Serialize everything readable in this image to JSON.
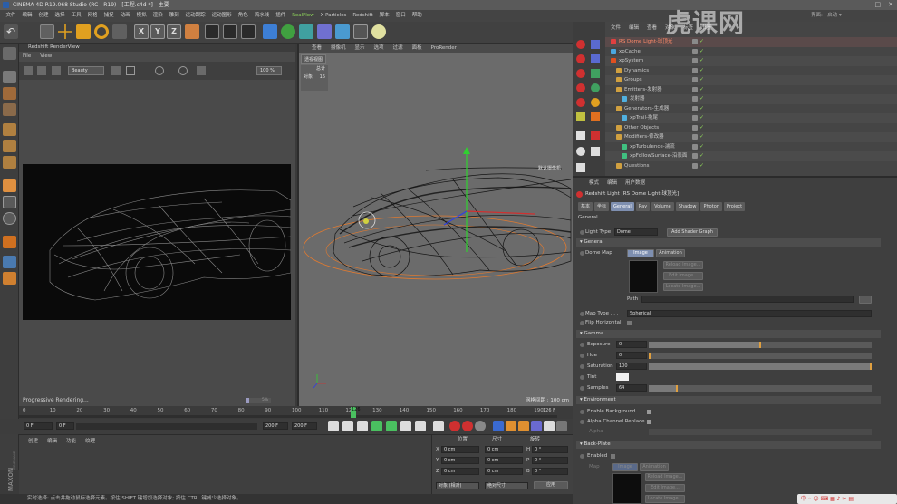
{
  "window": {
    "title": "CINEMA 4D R19.068 Studio (RC - R19) - [工程.c4d *] - 主要",
    "controls": [
      "—",
      "□",
      "✕"
    ],
    "layout_label": "界面: | 启动 ▾"
  },
  "menubar": [
    "文件",
    "编辑",
    "创建",
    "选择",
    "工具",
    "网格",
    "捕捉",
    "动画",
    "模拟",
    "渲染",
    "雕刻",
    "运动跟踪",
    "运动图形",
    "角色",
    "流水线",
    "插件",
    "RealFlow",
    "X-Particles",
    "Redshift",
    "脚本",
    "窗口",
    "帮助"
  ],
  "toolbar": {
    "axes": [
      "X",
      "Y",
      "Z"
    ]
  },
  "render_view": {
    "title": "Redshift RenderView",
    "menu": [
      "File",
      "View"
    ],
    "aov": "Beauty",
    "zoom": "100 %",
    "status": "Progressive Rendering...",
    "progress_label": "5%"
  },
  "viewport": {
    "menu": [
      "查看",
      "摄像机",
      "显示",
      "选项",
      "过滤",
      "面板",
      "ProRender"
    ],
    "tab": "透视视图",
    "stats_title": "总计",
    "stats_label": "对象",
    "stats_value": "16",
    "camera_label": "默认摄像机",
    "scale": "网格间距 : 100 cm"
  },
  "object_manager": {
    "menu": [
      "文件",
      "编辑",
      "查看",
      "对象",
      "标签",
      "书签"
    ],
    "items": [
      {
        "name": "RS Dome Light-球顶光",
        "indent": 0,
        "color": "#e04040",
        "selected": true
      },
      {
        "name": "xpCache",
        "indent": 0,
        "color": "#4aa8e0"
      },
      {
        "name": "xpSystem",
        "indent": 0,
        "color": "#e05020"
      },
      {
        "name": "Dynamics",
        "indent": 1,
        "color": "#d0a040"
      },
      {
        "name": "Groups",
        "indent": 1,
        "color": "#d0a040"
      },
      {
        "name": "Emitters-发射器",
        "indent": 1,
        "color": "#d0a040"
      },
      {
        "name": "发射器",
        "indent": 2,
        "color": "#50b0e0"
      },
      {
        "name": "Generators-生成器",
        "indent": 1,
        "color": "#d0a040"
      },
      {
        "name": "xpTrail-拖尾",
        "indent": 2,
        "color": "#50b0e0"
      },
      {
        "name": "Other Objects",
        "indent": 1,
        "color": "#d0a040"
      },
      {
        "name": "Modifiers-修改器",
        "indent": 1,
        "color": "#d0a040"
      },
      {
        "name": "xpTurbulence-湍流",
        "indent": 2,
        "color": "#40c080"
      },
      {
        "name": "xpFollowSurface-沿表面",
        "indent": 2,
        "color": "#40c080"
      },
      {
        "name": "Questions",
        "indent": 1,
        "color": "#d0a040"
      }
    ]
  },
  "attributes": {
    "menu": [
      "模式",
      "编辑",
      "用户数据"
    ],
    "header": "Redshift Light [RS Dome Light-球顶光]",
    "tabs": [
      {
        "label": "基本",
        "active": false
      },
      {
        "label": "坐标",
        "active": false
      },
      {
        "label": "General",
        "active": true
      },
      {
        "label": "Ray",
        "active": false
      },
      {
        "label": "Volume",
        "active": false
      },
      {
        "label": "Shadow",
        "active": false
      },
      {
        "label": "Photon",
        "active": false
      },
      {
        "label": "Project",
        "active": false
      }
    ],
    "section_general": "General",
    "light_type_label": "Light Type",
    "light_type_value": "Dome",
    "add_shader_graph": "Add Shader Graph",
    "sub_general": "▾ General",
    "dome_map_label": "Dome Map",
    "dome_tabs": [
      "Image",
      "Animation"
    ],
    "reload_image": "Reload Image...",
    "edit_image": "Edit Image...",
    "locate_image": "Locate Image...",
    "path_label": "Path",
    "map_type_label": "Map Type . . .",
    "map_type_value": "Spherical",
    "flip_horizontal": "Flip Horizontal",
    "sub_gamma": "▾ Gamma",
    "exposure_label": "Exposure",
    "exposure_value": "0",
    "hue_label": "Hue",
    "hue_value": "0",
    "saturation_label": "Saturation",
    "saturation_value": "100",
    "tint_label": "Tint",
    "samples_label": "Samples",
    "samples_value": "64",
    "section_environment": "▾ Environment",
    "enable_background": "Enable Background",
    "alpha_channel_replace": "Alpha Channel Replace",
    "alpha_label": "Alpha",
    "section_backplate": "▾ Back-Plate",
    "enabled_label": "Enabled",
    "map_label": "Map"
  },
  "timeline": {
    "ticks": [
      "0",
      "10",
      "20",
      "30",
      "40",
      "50",
      "60",
      "70",
      "80",
      "90",
      "100",
      "110",
      "120",
      "130",
      "140",
      "150",
      "160",
      "170",
      "180",
      "190"
    ],
    "current_frame": "126",
    "end_label": "126 F",
    "start_field": "0 F",
    "start_field2": "0 F",
    "end_field": "200 F",
    "end_field2": "200 F"
  },
  "materials": {
    "menu": [
      "创建",
      "编辑",
      "功能",
      "纹理"
    ]
  },
  "coordinates": {
    "headers": [
      "位置",
      "尺寸",
      "旋转"
    ],
    "rows": [
      {
        "axis": "X",
        "pos": "0 cm",
        "size": "0 cm",
        "rot_axis": "H",
        "rot": "0 °"
      },
      {
        "axis": "Y",
        "pos": "0 cm",
        "size": "0 cm",
        "rot_axis": "P",
        "rot": "0 °"
      },
      {
        "axis": "Z",
        "pos": "0 cm",
        "size": "0 cm",
        "rot_axis": "B",
        "rot": "0 °"
      }
    ],
    "mode_object": "对象 (相对)",
    "mode_size": "绝对尺寸",
    "apply": "应用"
  },
  "statusbar": "实时选择: 点击并拖动鼠标选择元素。按住 SHIFT 键增加选择对象; 按住 CTRL 键减少选择对象。",
  "watermark": "虎课网",
  "ime": "中 ◦ ☺ ⌨ ▦ ♪ ✂ ▤",
  "colors": {
    "accent_green": "#8fd65a",
    "selected_red": "#e04040",
    "tab_active": "#7e8fb0"
  }
}
